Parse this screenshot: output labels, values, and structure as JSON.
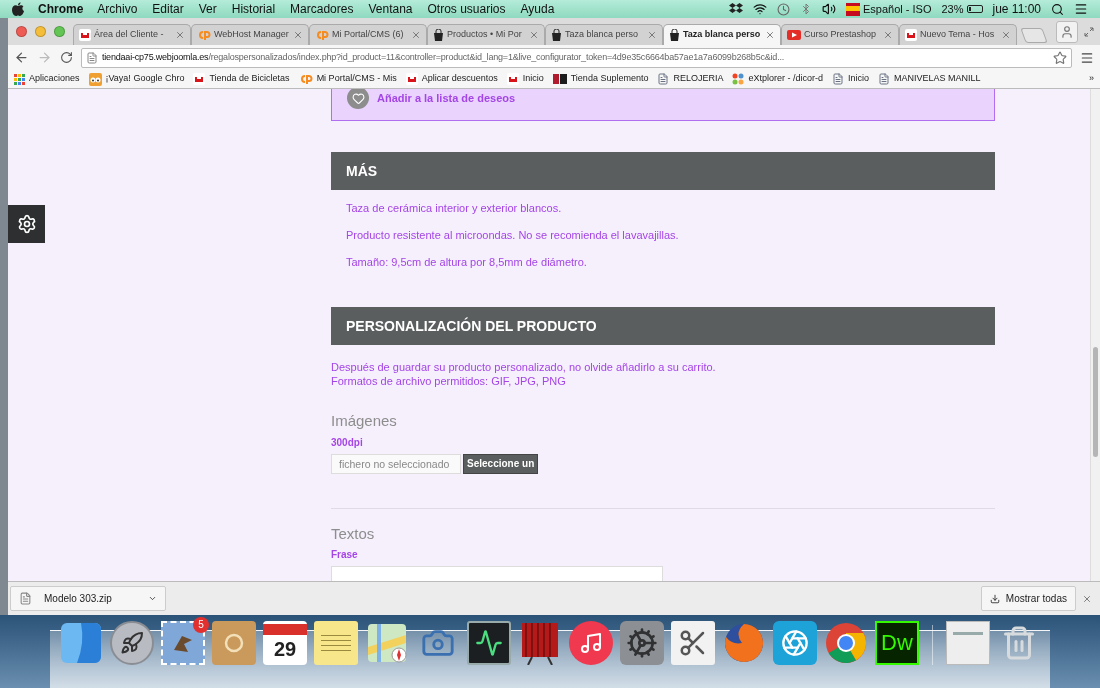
{
  "menu_bar": {
    "app": "Chrome",
    "items": [
      "Archivo",
      "Editar",
      "Ver",
      "Historial",
      "Marcadores",
      "Ventana",
      "Otros usuarios",
      "Ayuda"
    ],
    "language": "Español - ISO",
    "battery": "23%",
    "clock": "jue 11:00"
  },
  "tabs": [
    {
      "title": "Área del Cliente -",
      "kind": "w",
      "selected": false
    },
    {
      "title": "WebHost Manager",
      "kind": "cp",
      "selected": false
    },
    {
      "title": "Mi Portal/CMS (6)",
      "kind": "cp",
      "selected": false
    },
    {
      "title": "Productos • Mi Por",
      "kind": "bag",
      "selected": false
    },
    {
      "title": "Taza blanca perso",
      "kind": "bag",
      "selected": false
    },
    {
      "title": "Taza blanca perso",
      "kind": "bag",
      "selected": true
    },
    {
      "title": "Curso Prestashop",
      "kind": "play",
      "selected": false
    },
    {
      "title": "Nuevo Tema - Hos",
      "kind": "w",
      "selected": false
    }
  ],
  "address_bar": {
    "host": "tiendaai-cp75.webjoomla.es",
    "path": "/regalospersonalizados/index.php?id_product=11&controller=product&id_lang=1&live_configurator_token=4d9e35c6664ba57ae1a7a6099b268b5c&id..."
  },
  "bookmarks": [
    {
      "label": "Aplicaciones",
      "kind": "grid"
    },
    {
      "label": "¡Vaya! Google Chro",
      "kind": "eyes"
    },
    {
      "label": "Tienda de Bicicletas",
      "kind": "w"
    },
    {
      "label": "Mi Portal/CMS - Mis",
      "kind": "cp"
    },
    {
      "label": "Aplicar descuentos",
      "kind": "w"
    },
    {
      "label": "Inicio",
      "kind": "w"
    },
    {
      "label": "Tienda Suplemento",
      "kind": "nm"
    },
    {
      "label": "RELOJERIA",
      "kind": "page"
    },
    {
      "label": "eXtplorer - /dicor-d",
      "kind": "joomla"
    },
    {
      "label": "Inicio",
      "kind": "page"
    },
    {
      "label": "MANIVELAS MANILL",
      "kind": "page"
    }
  ],
  "bookmarks_more": "»",
  "page": {
    "wishlist": "Añadir a la lista de deseos",
    "more": {
      "heading": "MÁS",
      "lines": [
        "Taza de cerámica interior y exterior blancos.",
        "Producto resistente al microondas. No se recomienda el lavavajillas.",
        "Tamaño: 9,5cm de altura por 8,5mm de diámetro."
      ]
    },
    "customization": {
      "heading": "PERSONALIZACIÓN DEL PRODUCTO",
      "notes": [
        "Después de guardar su producto personalizado, no olvide añadirlo a su carrito.",
        "Formatos de archivo permitidos: GIF, JPG, PNG"
      ],
      "images": {
        "title": "Imágenes",
        "label": "300dpi",
        "file_status": "fichero no seleccionado",
        "file_button": "Seleccione un"
      },
      "texts": {
        "title": "Textos",
        "label": "Frase"
      }
    }
  },
  "downloads": {
    "file": "Modelo 303.zip",
    "show_all": "Mostrar todas"
  },
  "dock": [
    {
      "kind": "finder"
    },
    {
      "kind": "rocket"
    },
    {
      "kind": "mail",
      "badge": "5"
    },
    {
      "kind": "contacts"
    },
    {
      "kind": "calendar",
      "text": "29"
    },
    {
      "kind": "notes"
    },
    {
      "kind": "maps"
    },
    {
      "kind": "camera"
    },
    {
      "kind": "monitor"
    },
    {
      "kind": "theater"
    },
    {
      "kind": "music"
    },
    {
      "kind": "settings"
    },
    {
      "kind": "scissors"
    },
    {
      "kind": "firefox"
    },
    {
      "kind": "aperture"
    },
    {
      "kind": "chrome"
    },
    {
      "kind": "dreamweaver",
      "text": "Dw"
    },
    {
      "kind": "separator"
    },
    {
      "kind": "document"
    },
    {
      "kind": "trash"
    }
  ]
}
